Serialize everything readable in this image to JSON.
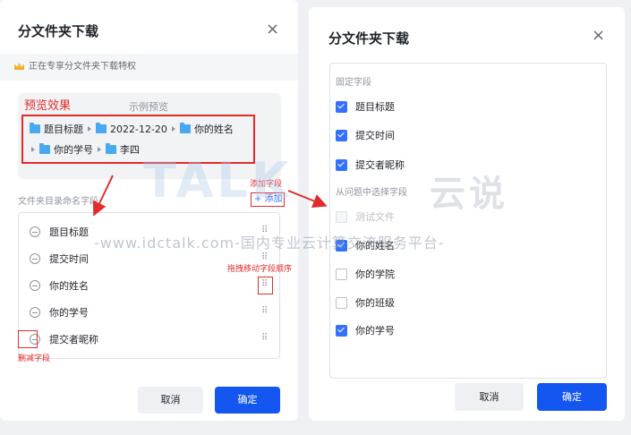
{
  "left_dialog": {
    "title": "分文件夹下载",
    "close": "×",
    "privilege_text": "正在专享分文件夹下载特权",
    "preview": {
      "annotation": "预览效果",
      "caption": "示例预览",
      "row1": [
        "题目标题",
        "2022-12-20",
        "你的姓名"
      ],
      "row2": [
        "你的学号",
        "李四"
      ]
    },
    "directory_label": "文件夹目录命名字段",
    "add_annotation": "添加字段",
    "add_button": "+ 添加",
    "fields": [
      "题目标题",
      "提交时间",
      "你的姓名",
      "你的学号",
      "提交者昵称"
    ],
    "drag_annotation": "拖拽移动字段顺序",
    "delete_annotation": "删减字段",
    "cancel": "取消",
    "confirm": "确定"
  },
  "right_dialog": {
    "title": "分文件夹下载",
    "close": "×",
    "fixed_label": "固定字段",
    "fixed_fields": [
      {
        "label": "题目标题",
        "checked": true
      },
      {
        "label": "提交时间",
        "checked": true
      },
      {
        "label": "提交者昵称",
        "checked": true
      }
    ],
    "question_label": "从问题中选择字段",
    "question_fields": [
      {
        "label": "测试文件",
        "checked": false,
        "disabled": true
      },
      {
        "label": "你的姓名",
        "checked": true
      },
      {
        "label": "你的学院",
        "checked": false
      },
      {
        "label": "你的班级",
        "checked": false
      },
      {
        "label": "你的学号",
        "checked": true
      }
    ],
    "cancel": "取消",
    "confirm": "确定"
  },
  "watermark": {
    "url_text": "-www.idctalk.com-国内专业云计算交流服务平台-",
    "brand": "TALK",
    "brand_cn": "云说"
  },
  "colors": {
    "primary": "#1456f0",
    "checkbox": "#3370ff",
    "annotation_red": "#e22b2b",
    "folder_blue": "#4aa8f0"
  },
  "icons": [
    "crown-icon",
    "close-icon",
    "folder-icon",
    "triangle-right-icon",
    "minus-circle-icon",
    "drag-grip-icon",
    "checkbox-icon"
  ]
}
